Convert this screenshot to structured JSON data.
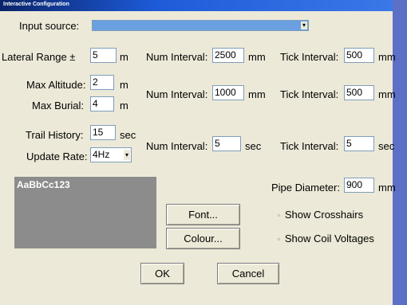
{
  "window": {
    "title": "Interactive Configuration"
  },
  "input_source": {
    "label": "Input source:",
    "value": "",
    "dropdown_arrow": "▾"
  },
  "lateral_range": {
    "label": "Lateral Range ±",
    "value": "5",
    "unit": "m",
    "num_interval_label": "Num Interval:",
    "num_interval_value": "2500",
    "num_interval_unit": "mm",
    "tick_interval_label": "Tick Interval:",
    "tick_interval_value": "500",
    "tick_interval_unit": "mm"
  },
  "altitude": {
    "max_altitude_label": "Max Altitude:",
    "max_altitude_value": "2",
    "max_altitude_unit": "m",
    "max_burial_label": "Max Burial:",
    "max_burial_value": "4",
    "max_burial_unit": "m",
    "num_interval_label": "Num Interval:",
    "num_interval_value": "1000",
    "num_interval_unit": "mm",
    "tick_interval_label": "Tick Interval:",
    "tick_interval_value": "500",
    "tick_interval_unit": "mm"
  },
  "trail": {
    "trail_history_label": "Trail History:",
    "trail_history_value": "15",
    "trail_history_unit": "sec",
    "update_rate_label": "Update Rate:",
    "update_rate_value": "4Hz",
    "dropdown_arrow": "▾",
    "num_interval_label": "Num Interval:",
    "num_interval_value": "5",
    "num_interval_unit": "sec",
    "tick_interval_label": "Tick Interval:",
    "tick_interval_value": "5",
    "tick_interval_unit": "sec"
  },
  "font_preview": {
    "text": "AaBbCc123"
  },
  "buttons": {
    "font": "Font...",
    "colour": "Colour...",
    "ok": "OK",
    "cancel": "Cancel"
  },
  "pipe": {
    "label": "Pipe Diameter:",
    "value": "900",
    "unit": "mm"
  },
  "options": {
    "show_crosshairs": "Show Crosshairs",
    "show_coil_voltages": "Show Coil Voltages",
    "checkbox_glyph": "▫"
  }
}
